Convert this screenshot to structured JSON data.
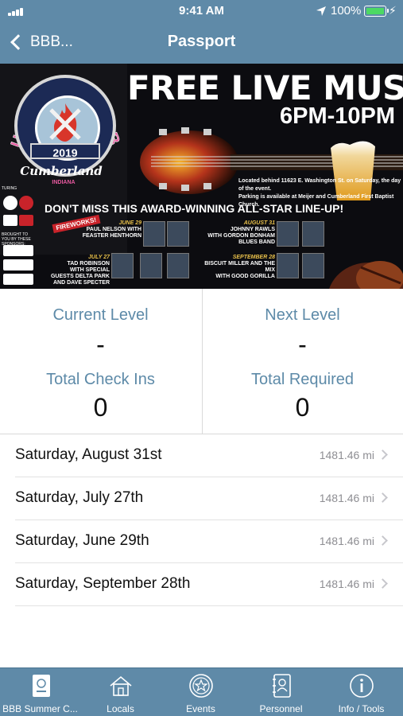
{
  "status_bar": {
    "time": "9:41 AM",
    "battery": "100%"
  },
  "nav": {
    "back_label": "BBB...",
    "title": "Passport"
  },
  "banner": {
    "festival_words": "BLUES, BEER, & BBQ",
    "festival_year": "2019",
    "festival_town": "Cumberland",
    "festival_state": "INDIANA",
    "headline": "FREE LIVE MUSIC",
    "hours": "6PM-10PM",
    "venue_line_1": "Located behind 11623 E. Washington St. on Saturday, the day of the event.",
    "venue_line_2": "Parking is available at Meijer and Cumberland First Baptist Church.",
    "lineup_heading": "DON'T MISS THIS AWARD-WINNING ALL-STAR LINE-UP!",
    "fireworks": "FIREWORKS!",
    "sponsor_note_1": "TURING",
    "sponsor_note_2": "BROUGHT TO YOU BY THESE SPONSORS:",
    "acts": [
      {
        "date": "JUNE 29",
        "line1": "PAUL NELSON WITH",
        "line2": "FEASTER HENTHORN"
      },
      {
        "date": "JULY 27",
        "line1": "TAD ROBINSON",
        "line2": "WITH SPECIAL GUESTS DELTA PARK AND DAVE SPECTER"
      },
      {
        "date": "AUGUST 31",
        "line1": "JOHNNY RAWLS",
        "line2": "WITH GORDON BONHAM BLUES BAND"
      },
      {
        "date": "SEPTEMBER 28",
        "line1": "BISCUIT MILLER AND THE MIX",
        "line2": "WITH GOOD GORILLA"
      }
    ]
  },
  "stats": {
    "current_level_label": "Current Level",
    "current_level_value": "-",
    "next_level_label": "Next Level",
    "next_level_value": "-",
    "total_checkins_label": "Total Check Ins",
    "total_checkins_value": "0",
    "total_required_label": "Total Required",
    "total_required_value": "0"
  },
  "events": [
    {
      "name": "Saturday, August 31st",
      "distance": "1481.46 mi"
    },
    {
      "name": "Saturday, July 27th",
      "distance": "1481.46 mi"
    },
    {
      "name": "Saturday, June 29th",
      "distance": "1481.46 mi"
    },
    {
      "name": "Saturday, September 28th",
      "distance": "1481.46 mi"
    }
  ],
  "tabs": [
    {
      "label": "BBB Summer C...",
      "icon": "passport-icon"
    },
    {
      "label": "Locals",
      "icon": "house-icon"
    },
    {
      "label": "Events",
      "icon": "star-badge-icon"
    },
    {
      "label": "Personnel",
      "icon": "contact-book-icon"
    },
    {
      "label": "Info / Tools",
      "icon": "info-icon"
    }
  ],
  "colors": {
    "bar": "#5f8aa8",
    "accent_text": "#5d8aa8",
    "battery": "#4cd964"
  }
}
